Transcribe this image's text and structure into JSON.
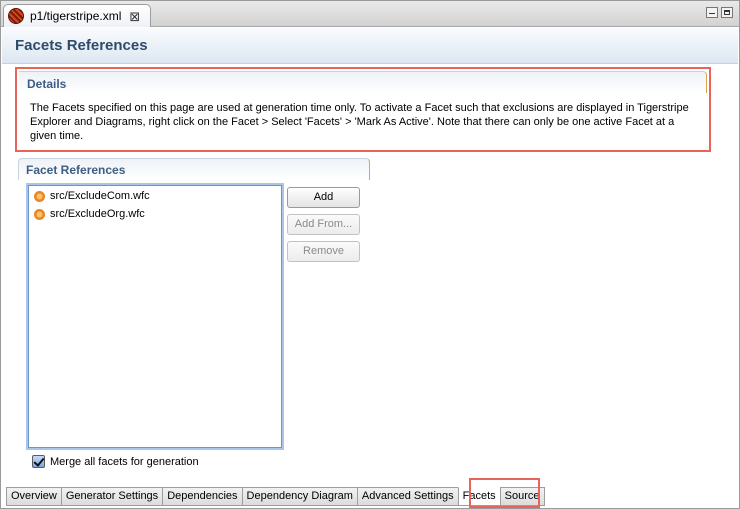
{
  "editor_tab": {
    "title": "p1/tigerstripe.xml",
    "icon": "tigerstripe-file-icon",
    "close": "⊠"
  },
  "form": {
    "title": "Facets References"
  },
  "details": {
    "title": "Details",
    "text": "The Facets specified on this page are used at generation time only. To activate a Facet such that exclusions are displayed in Tigerstripe Explorer and Diagrams, right click on the Facet > Select 'Facets' > 'Mark As Active'. Note that there can only be one active Facet at a given time."
  },
  "facet_references": {
    "title": "Facet References",
    "items": [
      {
        "label": "src/ExcludeCom.wfc",
        "icon": "facet-icon"
      },
      {
        "label": "src/ExcludeOrg.wfc",
        "icon": "facet-icon"
      }
    ],
    "buttons": {
      "add": "Add",
      "add_from": "Add From...",
      "remove": "Remove"
    }
  },
  "merge": {
    "label": "Merge all facets for generation",
    "checked": true
  },
  "page_tabs": [
    {
      "label": "Overview"
    },
    {
      "label": "Generator Settings"
    },
    {
      "label": "Dependencies"
    },
    {
      "label": "Dependency Diagram"
    },
    {
      "label": "Advanced Settings"
    },
    {
      "label": "Facets",
      "active": true
    },
    {
      "label": "Source"
    }
  ],
  "colors": {
    "highlight": "#e8645a",
    "title": "#2f4a6b",
    "section_title": "#3d5d84",
    "accent_border": "#e2a24a"
  }
}
